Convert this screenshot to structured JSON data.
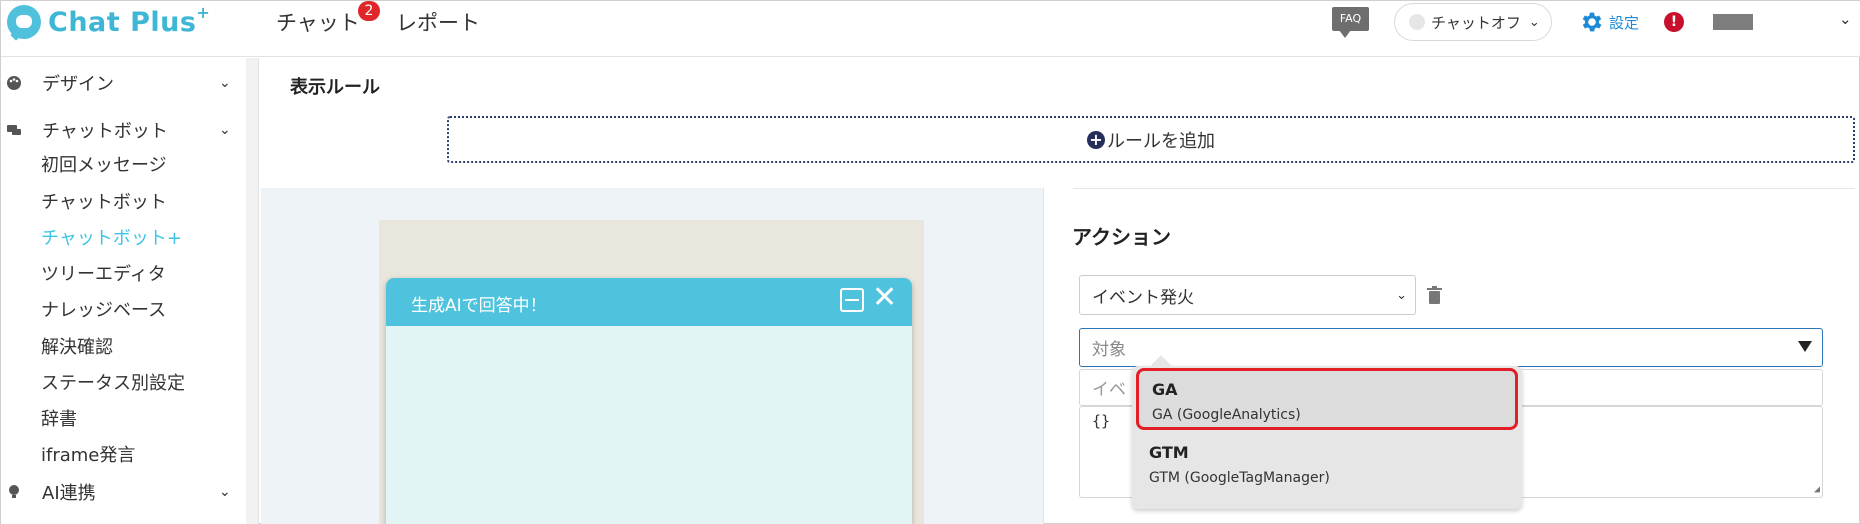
{
  "header": {
    "logo_text": "Chat Plus",
    "logo_sup": "+",
    "nav": [
      {
        "label": "チャット",
        "badge": "2"
      },
      {
        "label": "レポート"
      }
    ],
    "faq_label": "FAQ",
    "status_label": "チャットオフ",
    "settings_label": "設定",
    "alert_symbol": "!"
  },
  "sidebar": {
    "groups": [
      {
        "label": "デザイン",
        "icon": "palette-icon"
      },
      {
        "label": "チャットボット",
        "icon": "chat-bubbles-icon"
      },
      {
        "label": "AI連携",
        "icon": "bulb-icon"
      }
    ],
    "items": [
      {
        "label": "初回メッセージ"
      },
      {
        "label": "チャットボット"
      },
      {
        "label": "チャットボット+",
        "active": true
      },
      {
        "label": "ツリーエディタ"
      },
      {
        "label": "ナレッジベース"
      },
      {
        "label": "解決確認"
      },
      {
        "label": "ステータス別設定"
      },
      {
        "label": "辞書"
      },
      {
        "label": "iframe発言"
      }
    ],
    "active_color": "#3ec4e4"
  },
  "main": {
    "section_title": "表示ルール",
    "add_rule_label": "ルールを追加"
  },
  "preview": {
    "chat_title": "生成AIで回答中！",
    "header_color": "#4fc3dd"
  },
  "action": {
    "title": "アクション",
    "event_value": "イベント発火",
    "target_placeholder": "対象",
    "event_name_placeholder": "イベ",
    "json_value": "{}",
    "dropdown": [
      {
        "name": "GA",
        "desc": "GA (GoogleAnalytics)",
        "highlighted": true
      },
      {
        "name": "GTM",
        "desc": "GTM (GoogleTagManager)"
      }
    ],
    "highlight_color": "#e21f26"
  }
}
